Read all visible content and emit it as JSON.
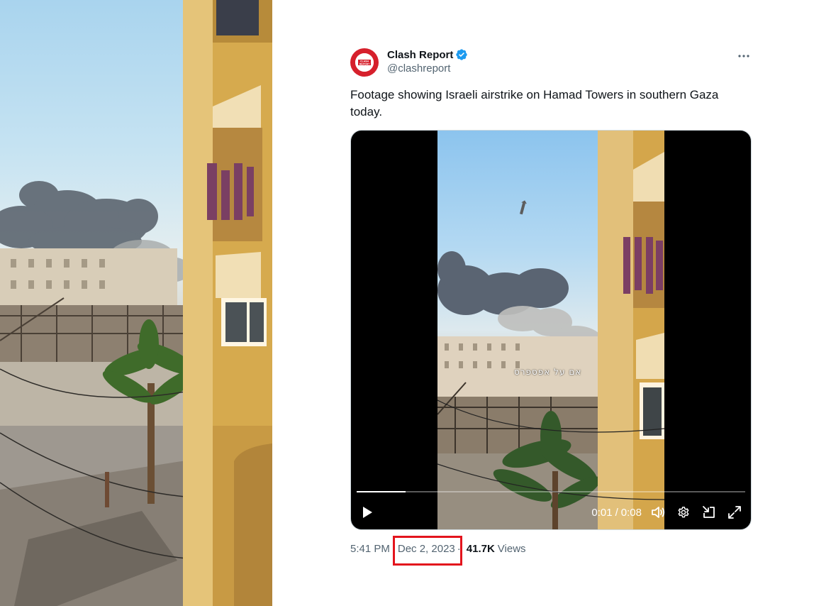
{
  "account": {
    "display_name": "Clash Report",
    "handle": "@clashreport",
    "avatar_text": "CLASH\nREPORT",
    "verified": true
  },
  "tweet": {
    "text": "Footage showing Israeli airstrike on Hamad Towers in southern Gaza today."
  },
  "video": {
    "overlay_caption": "אם על אפספרס",
    "current_time": "0:01",
    "separator": "/",
    "duration": "0:08",
    "progress": 0.125
  },
  "meta": {
    "time": "5:41 PM",
    "date": "Dec 2, 2023",
    "views_count": "41.7K",
    "views_label": "Views",
    "dot": "·"
  },
  "colors": {
    "verified": "#1d9bf0",
    "brand_red": "#d6202c",
    "highlight": "#e3141d"
  }
}
